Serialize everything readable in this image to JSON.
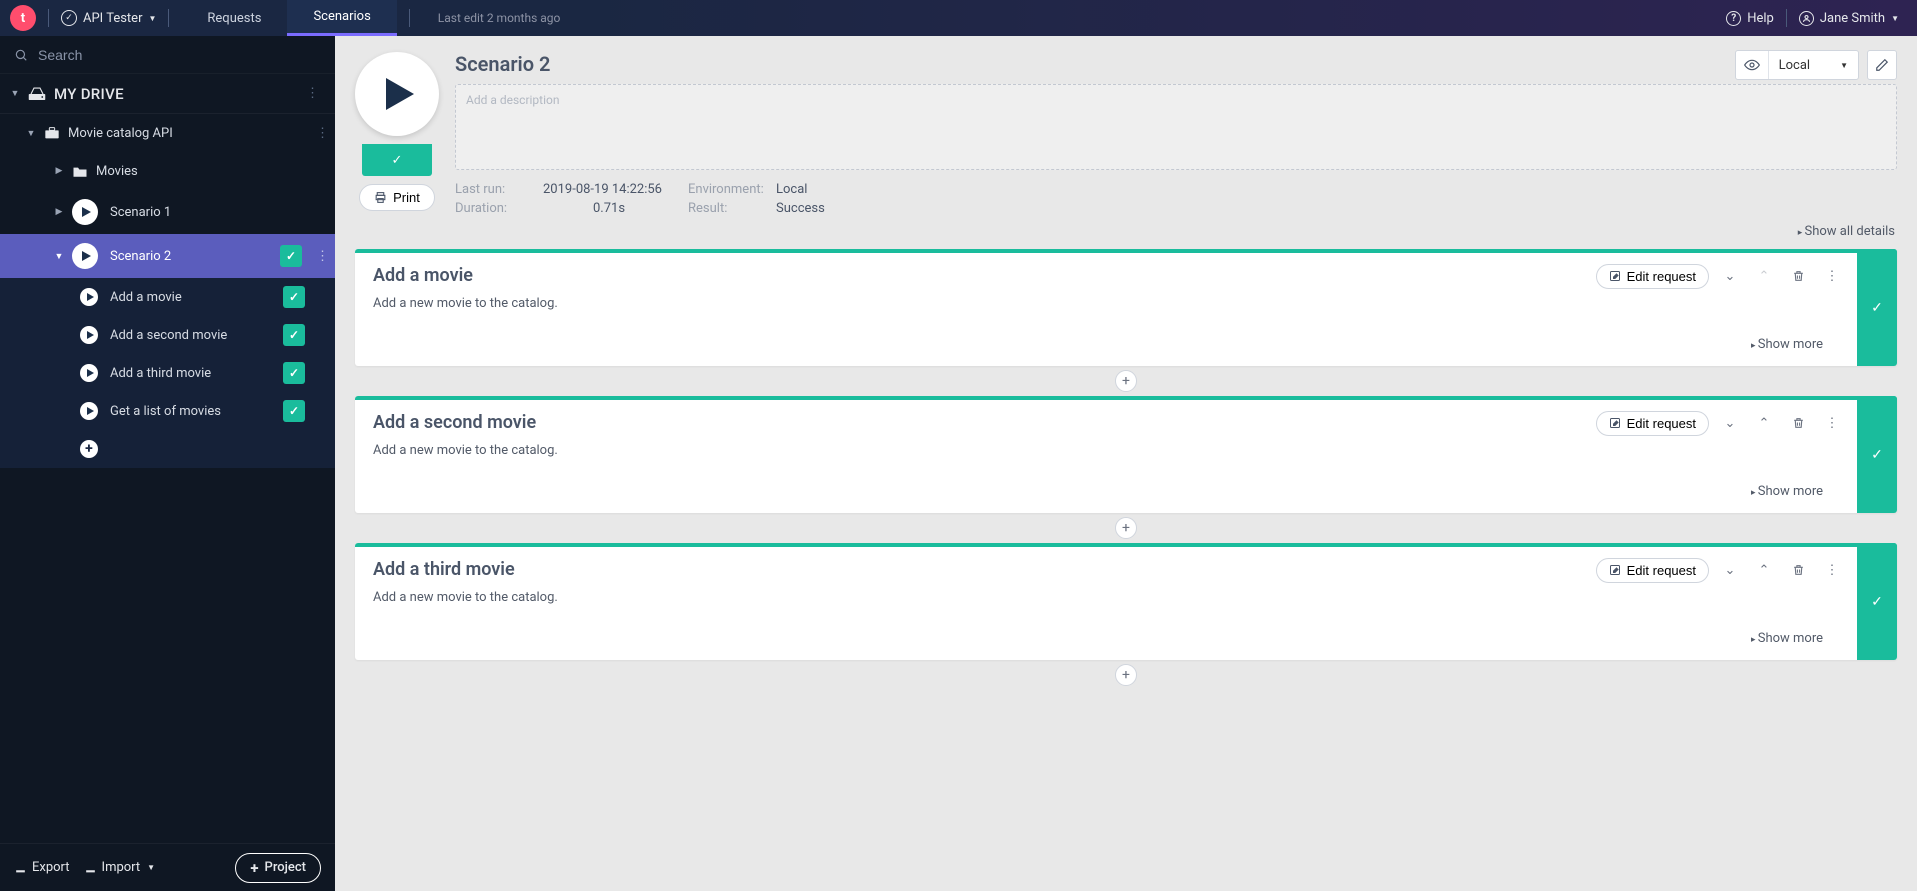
{
  "header": {
    "appName": "API Tester",
    "tabs": {
      "requests": "Requests",
      "scenarios": "Scenarios"
    },
    "lastEdit": "Last edit 2 months ago",
    "help": "Help",
    "user": "Jane Smith"
  },
  "sidebar": {
    "searchPlaceholder": "Search",
    "driveLabel": "MY DRIVE",
    "project": "Movie catalog API",
    "folder": "Movies",
    "scenario1": "Scenario 1",
    "scenario2": "Scenario 2",
    "subitems": [
      "Add a movie",
      "Add a second movie",
      "Add a third movie",
      "Get a list of movies"
    ],
    "export": "Export",
    "import": "Import",
    "projectBtn": "Project"
  },
  "main": {
    "title": "Scenario 2",
    "descPlaceholder": "Add a description",
    "print": "Print",
    "meta": {
      "lastRunLabel": "Last run:",
      "lastRunVal": "2019-08-19 14:22:56",
      "durationLabel": "Duration:",
      "durationVal": "0.71s",
      "envLabel": "Environment:",
      "envVal": "Local",
      "resultLabel": "Result:",
      "resultVal": "Success"
    },
    "envSelector": "Local",
    "showAll": "Show all details",
    "editRequest": "Edit request",
    "showMore": "Show more",
    "steps": [
      {
        "title": "Add a movie",
        "desc": "Add a new movie to the catalog."
      },
      {
        "title": "Add a second movie",
        "desc": "Add a new movie to the catalog."
      },
      {
        "title": "Add a third movie",
        "desc": "Add a new movie to the catalog."
      }
    ]
  }
}
